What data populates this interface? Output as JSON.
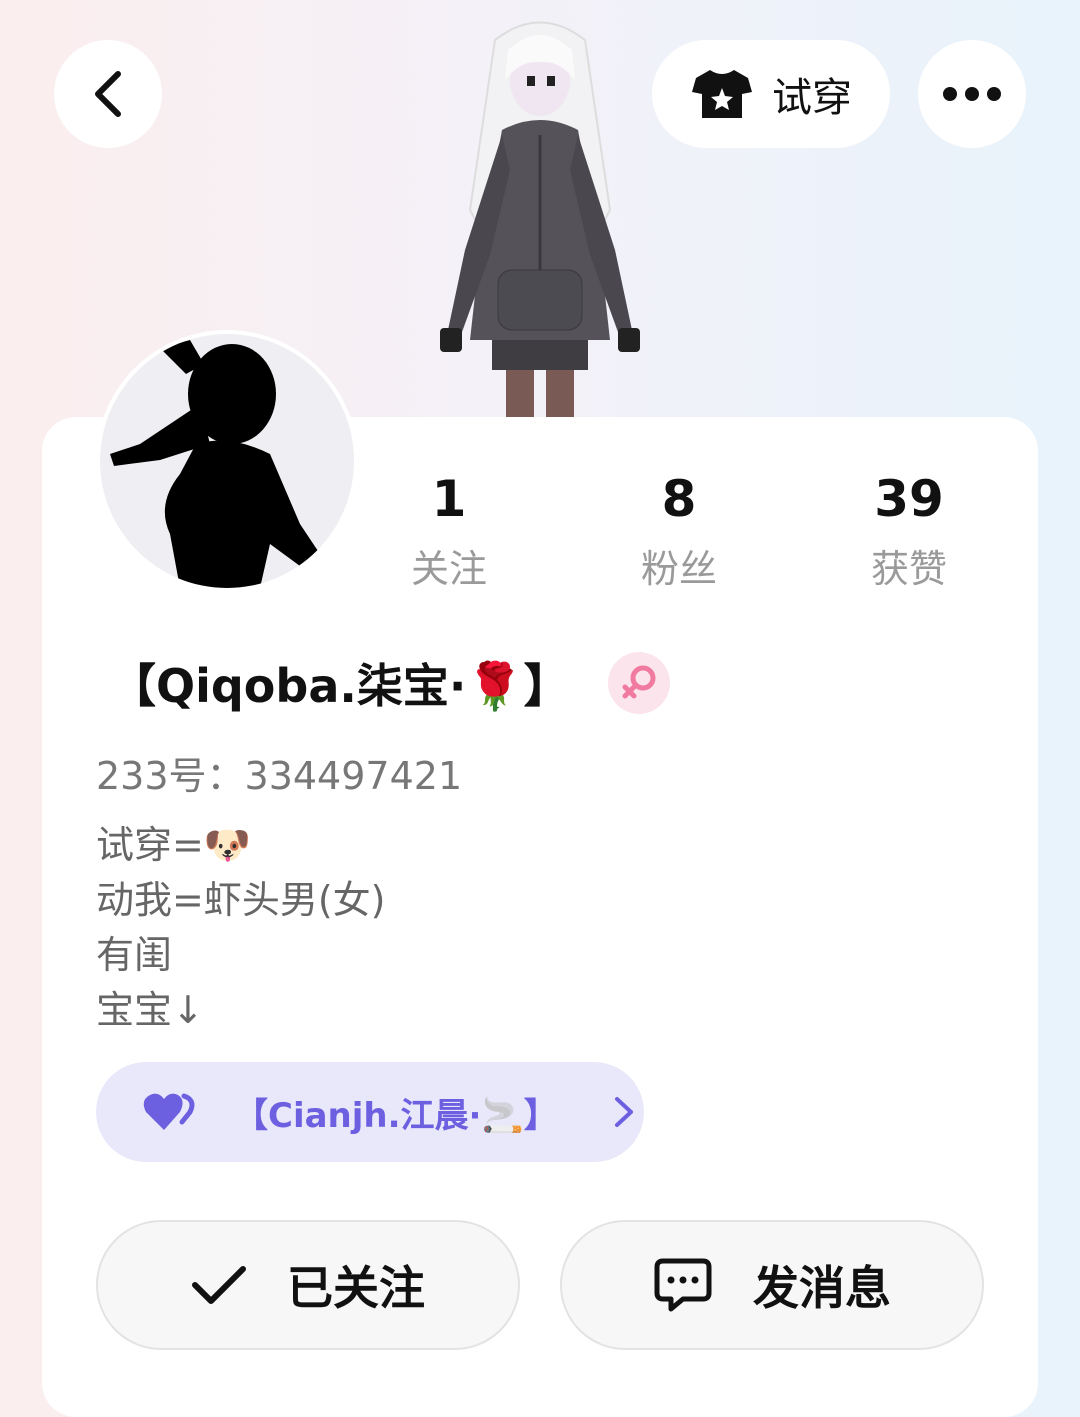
{
  "header": {
    "back_icon": "chevron-left-icon",
    "tryon_label": "试穿",
    "tryon_icon": "shirt-icon",
    "more_icon": "more-dots-icon"
  },
  "stats": [
    {
      "value": "1",
      "label": "关注"
    },
    {
      "value": "8",
      "label": "粉丝"
    },
    {
      "value": "39",
      "label": "获赞"
    }
  ],
  "profile": {
    "name": "【Qiqoba.柒宝·🌹】",
    "gender_icon": "female-icon",
    "uid": "233号：334497421",
    "bio": [
      "试穿=🐶",
      "动我=虾头男(女)",
      "有闺",
      "宝宝↓"
    ]
  },
  "cp_link": {
    "name": "【Cianjh.江晨·🚬】",
    "icon": "double-heart-icon"
  },
  "actions": {
    "follow_label": "已关注",
    "message_label": "发消息"
  },
  "colors": {
    "accent": "#6c5fe0",
    "cp_bg": "#e9e8fb",
    "gender_bg": "#fbe4ec"
  }
}
